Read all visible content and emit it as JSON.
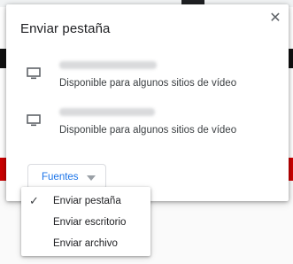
{
  "dialog": {
    "title": "Enviar pestaña",
    "close_icon": "close-icon"
  },
  "sinks": [
    {
      "icon": "monitor-icon",
      "status": "Disponible para algunos sitios de vídeo"
    },
    {
      "icon": "monitor-icon",
      "status": "Disponible para algunos sitios de vídeo"
    }
  ],
  "sources_button": {
    "label": "Fuentes",
    "icon": "caret-down-icon"
  },
  "sources_menu": {
    "items": [
      {
        "label": "Enviar pestaña",
        "checked": true
      },
      {
        "label": "Enviar escritorio",
        "checked": false
      },
      {
        "label": "Enviar archivo",
        "checked": false
      }
    ],
    "check_glyph": "✓"
  },
  "colors": {
    "accent": "#1a73e8",
    "background_red": "#cc0000"
  }
}
